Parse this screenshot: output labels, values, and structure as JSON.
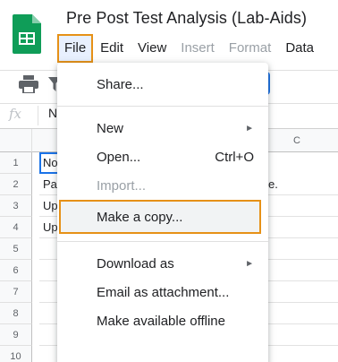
{
  "app": {
    "title": "Pre Post Test Analysis (Lab-Aids)",
    "icon": "google-sheets-logo-icon",
    "brand_color": "#0f9d58"
  },
  "menubar": {
    "items": [
      "File",
      "Edit",
      "View",
      "Insert",
      "Format",
      "Data"
    ],
    "active": "File"
  },
  "toolbar": {
    "icons": [
      "print-icon",
      "filter-icon"
    ]
  },
  "formula_bar": {
    "fx_label": "fx",
    "value": "N"
  },
  "sheet": {
    "column_headers": [
      "",
      "C"
    ],
    "row_numbers": [
      "1",
      "2",
      "3",
      "4",
      "5",
      "6",
      "7",
      "8",
      "9",
      "10"
    ],
    "cells_col_a": [
      "No",
      "Pa",
      "Up",
      "Up"
    ],
    "row2_tail": "e."
  },
  "file_menu": {
    "items": [
      {
        "label": "Share...",
        "shortcut": "",
        "submenu": false,
        "disabled": false
      },
      {
        "label": "New",
        "shortcut": "",
        "submenu": true,
        "disabled": false
      },
      {
        "label": "Open...",
        "shortcut": "Ctrl+O",
        "submenu": false,
        "disabled": false
      },
      {
        "label": "Import...",
        "shortcut": "",
        "submenu": false,
        "disabled": true
      },
      {
        "label": "Make a copy...",
        "shortcut": "",
        "submenu": false,
        "disabled": false,
        "highlighted": true
      },
      {
        "label": "Download as",
        "shortcut": "",
        "submenu": true,
        "disabled": false
      },
      {
        "label": "Email as attachment...",
        "shortcut": "",
        "submenu": false,
        "disabled": false
      },
      {
        "label": "Make available offline",
        "shortcut": "",
        "submenu": false,
        "disabled": false
      }
    ],
    "submenu_arrow": "►"
  },
  "colors": {
    "highlight_border": "#e69117",
    "accent_blue": "#1a73e8",
    "disabled_text": "#9aa0a6"
  }
}
